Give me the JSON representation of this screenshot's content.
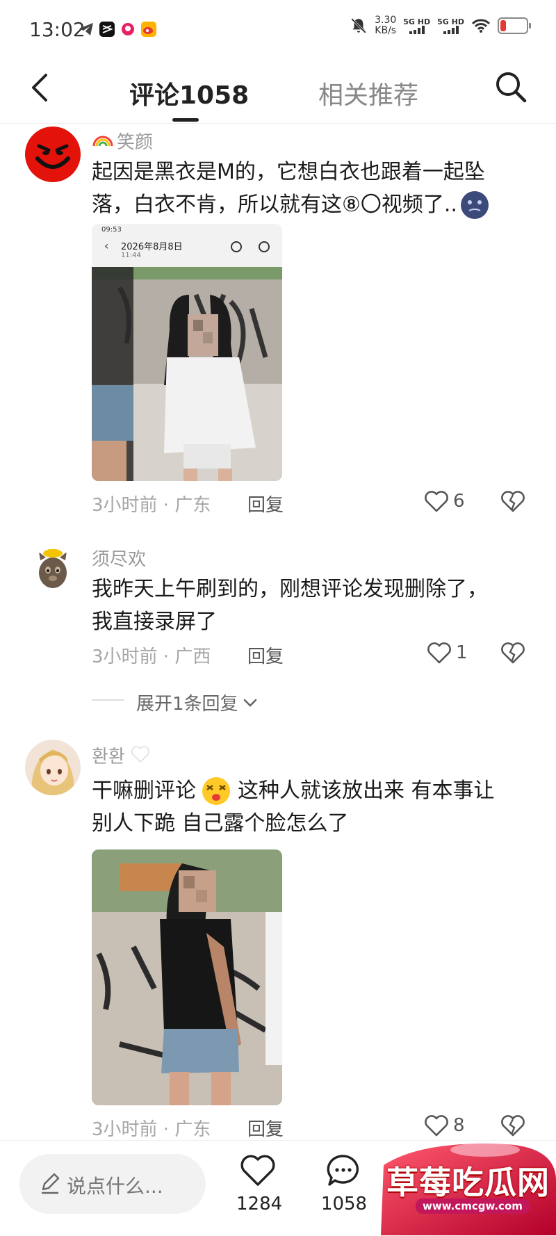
{
  "status_bar": {
    "time": "13:02",
    "speed_value": "3.30",
    "speed_unit": "KB/s",
    "signal_1": "5G HD",
    "signal_2": "5G HD"
  },
  "header": {
    "tab_comments": "评论1058",
    "tab_related": "相关推荐"
  },
  "comments": [
    {
      "username": "笑颜",
      "username_emoji": "rainbow-icon",
      "text_line1": "起因是黑衣是M的，它想白衣也跟着一起坠",
      "text_line2": "落，白衣不肯，所以就有这⑧〇视频了..",
      "image": {
        "inner_status_time": "09:53",
        "inner_date": "2026年8月8日",
        "inner_time": "11:44"
      },
      "time": "3小时前 · 广东",
      "reply_label": "回复",
      "likes": "6"
    },
    {
      "username": "须尽欢",
      "text_line1": "我昨天上午刷到的，刚想评论发现删除了，",
      "text_line2": "我直接录屏了",
      "time": "3小时前 · 广西",
      "reply_label": "回复",
      "likes": "1",
      "expand_label": "展开1条回复"
    },
    {
      "username": "환환",
      "username_emoji": "white-heart-icon",
      "text_part1": "干嘛删评论",
      "text_part2": "这种人就该放出来 有本事让",
      "text_line2": "别人下跪 自己露个脸怎么了",
      "time": "3小时前 · 广东",
      "reply_label": "回复",
      "likes": "8"
    }
  ],
  "bottom_bar": {
    "input_placeholder": "说点什么...",
    "like_count": "1284",
    "comment_count": "1058"
  },
  "watermark": {
    "title": "草莓吃瓜网",
    "url": "www.cmcgw.com"
  },
  "colors": {
    "text": "#1a1a1a",
    "muted": "#9a9a9a",
    "watermark_red": "#d81b3c"
  }
}
